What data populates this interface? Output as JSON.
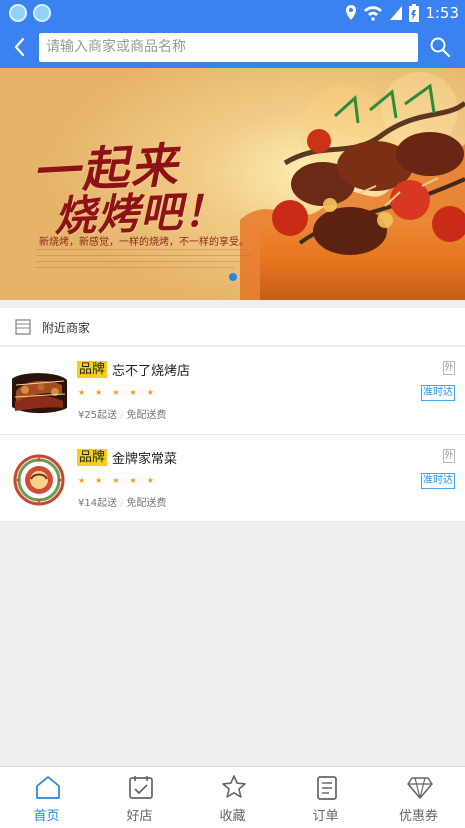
{
  "status_bar": {
    "time": "1:53",
    "icons": [
      "app-icon",
      "app-icon",
      "location-icon",
      "wifi-icon",
      "signal-icon",
      "battery-icon"
    ],
    "battery_level": 0.72,
    "color": "#3a82f0"
  },
  "search": {
    "placeholder": "请输入商家或商品名称"
  },
  "banner": {
    "title_line_1": "一起来",
    "title_line_2": "烧烤吧！",
    "subtitle": "新烧烤，新感觉，一样的烧烤，不一样的享受。",
    "active_slide": 1,
    "slide_count": 1
  },
  "section": {
    "title": "附近商家",
    "icon": "store-icon"
  },
  "merchants": [
    {
      "brand_badge": "品牌",
      "name": "忘不了烧烤店",
      "rating_stars": 5,
      "min_order": "¥25起送",
      "delivery_fee": "免配送费",
      "tag_out": "外",
      "tag_ontime": "准时达",
      "thumbnail": "bbq-food-image"
    },
    {
      "brand_badge": "品牌",
      "name": "金牌家常菜",
      "rating_stars": 5,
      "min_order": "¥14起送",
      "delivery_fee": "免配送费",
      "tag_out": "外",
      "tag_ontime": "准时达",
      "thumbnail": "restaurant-logo-image"
    }
  ],
  "bottom_nav": [
    {
      "label": "首页",
      "icon": "home-icon",
      "active": true
    },
    {
      "label": "好店",
      "icon": "calendar-check-icon",
      "active": false
    },
    {
      "label": "收藏",
      "icon": "star-icon",
      "active": false
    },
    {
      "label": "订单",
      "icon": "order-list-icon",
      "active": false
    },
    {
      "label": "优惠券",
      "icon": "diamond-icon",
      "active": false
    }
  ],
  "colors": {
    "primary": "#3a82f0",
    "active_nav": "#1d85f0",
    "brand_badge": "#f5cf1b",
    "rating": "#f19b15",
    "ontime_tag": "#1b91f0"
  }
}
